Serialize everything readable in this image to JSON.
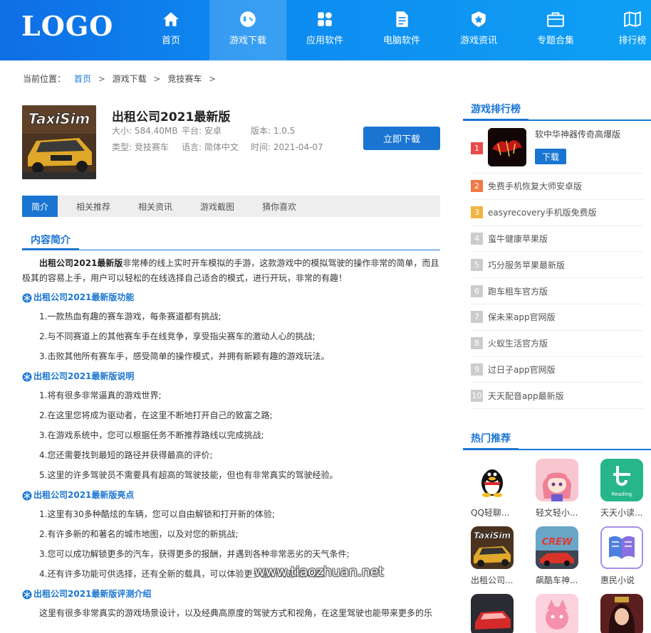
{
  "header": {
    "logo": "LOGO",
    "nav": [
      {
        "label": "首页",
        "icon": "home-icon"
      },
      {
        "label": "游戏下载",
        "icon": "gamepad-icon",
        "active": true
      },
      {
        "label": "应用软件",
        "icon": "apps-icon"
      },
      {
        "label": "电脑软件",
        "icon": "document-icon"
      },
      {
        "label": "游戏资讯",
        "icon": "star-badge-icon"
      },
      {
        "label": "专题合集",
        "icon": "briefcase-icon"
      },
      {
        "label": "排行榜",
        "icon": "map-icon"
      }
    ]
  },
  "breadcrumb": {
    "prefix": "当前位置：",
    "items": [
      "首页",
      "游戏下载",
      "竞技赛车"
    ],
    "sep": ">"
  },
  "app": {
    "title": "出租公司2021最新版",
    "thumb_text": "TaxiSim",
    "size": "大小: 584.40MB",
    "platform": "平台: 安卓",
    "version": "版本: 1.0.5",
    "type": "类型: 竞技赛车",
    "language": "语言: 简体中文",
    "time": "时间: 2021-04-07",
    "download_label": "立即下载"
  },
  "tabs": [
    "简介",
    "相关推荐",
    "相关资讯",
    "游戏截图",
    "猜你喜欢"
  ],
  "content": {
    "heading": "内容简介",
    "intro_bold": "出租公司2021最新版",
    "intro_rest": "非常棒的线上实时开车模拟的手游，这款游戏中的模拟驾驶的操作非常的简单，而且极其的容易上手，用户可以轻松的在线选择自己适合的模式，进行开玩，非常的有趣！",
    "sections": [
      {
        "title": "出租公司2021最新版功能",
        "items": [
          "1.一款热血有趣的赛车游戏，每条赛道都有挑战;",
          "2.与不同赛道上的其他赛车手在线竞争，享受指尖赛车的激动人心的挑战;",
          "3.击败其他所有赛车手，感受简单的操作模式，并拥有新颖有趣的游戏玩法。"
        ]
      },
      {
        "title": "出租公司2021最新版说明",
        "items": [
          "1.将有很多非常逼真的游戏世界;",
          "2.在这里您将成为驱动者，在这里不断地打开自己的致富之路;",
          "3.在游戏系统中，您可以根据任务不断推荐路线以完成挑战;",
          "4.您还需要找到最短的路径并获得最高的评价;",
          "5.这里的许多驾驶员不需要具有超高的驾驶技能，但也有非常真实的驾驶经验。"
        ]
      },
      {
        "title": "出租公司2021最新版亮点",
        "items": [
          "1.这里有30多种酷炫的车辆，您可以自由解锁和打开新的体验;",
          "2.有许多新的和著名的城市地图，以及对您的新挑战;",
          "3.您可以成功解锁更多的汽车，获得更多的报酬，并遇到各种非常恶劣的天气条件;",
          "4.还有许多功能可供选择，还有全新的载具，可以体验更多全新的游戏体验。"
        ]
      },
      {
        "title": "出租公司2021最新版评测介绍",
        "items": []
      }
    ],
    "tail": "这里有很多非常真实的游戏场景设计，以及经典高原度的驾驶方式和视角，在这里驾驶也能带来更多的乐"
  },
  "watermark": "www.tiaozhuan.net",
  "sidebar": {
    "rank_title": "游戏排行榜",
    "rank_top": {
      "num": "1",
      "name": "软中华神器传奇高爆版",
      "download": "下载"
    },
    "rank_list": [
      {
        "num": "2",
        "name": "免费手机恢复大师安卓版",
        "color": "#f07a48"
      },
      {
        "num": "3",
        "name": "easyrecovery手机版免费版",
        "color": "#f3b341"
      },
      {
        "num": "4",
        "name": "蛮牛健康苹果版",
        "color": "#cccccc"
      },
      {
        "num": "5",
        "name": "巧分服务苹果最新版",
        "color": "#cccccc"
      },
      {
        "num": "6",
        "name": "跑车租车官方版",
        "color": "#cccccc"
      },
      {
        "num": "7",
        "name": "保未来app官网版",
        "color": "#cccccc"
      },
      {
        "num": "8",
        "name": "火蚁生活官方版",
        "color": "#cccccc"
      },
      {
        "num": "9",
        "name": "过日子app官网版",
        "color": "#cccccc"
      },
      {
        "num": "10",
        "name": "天天配音app最新版",
        "color": "#cccccc"
      }
    ],
    "hot_title": "热门推荐",
    "hot": [
      {
        "label": "QQ轻聊...",
        "icon": "qq-penguin-icon"
      },
      {
        "label": "轻文轻小...",
        "icon": "anime-girl-icon"
      },
      {
        "label": "天天小读...",
        "icon": "reading-icon"
      },
      {
        "label": "出租公司...",
        "icon": "taxi-sim-icon"
      },
      {
        "label": "飙酷车神...",
        "icon": "crew-racing-icon"
      },
      {
        "label": "惠民小说",
        "icon": "book-icon"
      },
      {
        "label": "",
        "icon": "red-car-icon"
      },
      {
        "label": "",
        "icon": "pink-character-icon"
      },
      {
        "label": "",
        "icon": "warrior-girl-icon"
      }
    ]
  }
}
